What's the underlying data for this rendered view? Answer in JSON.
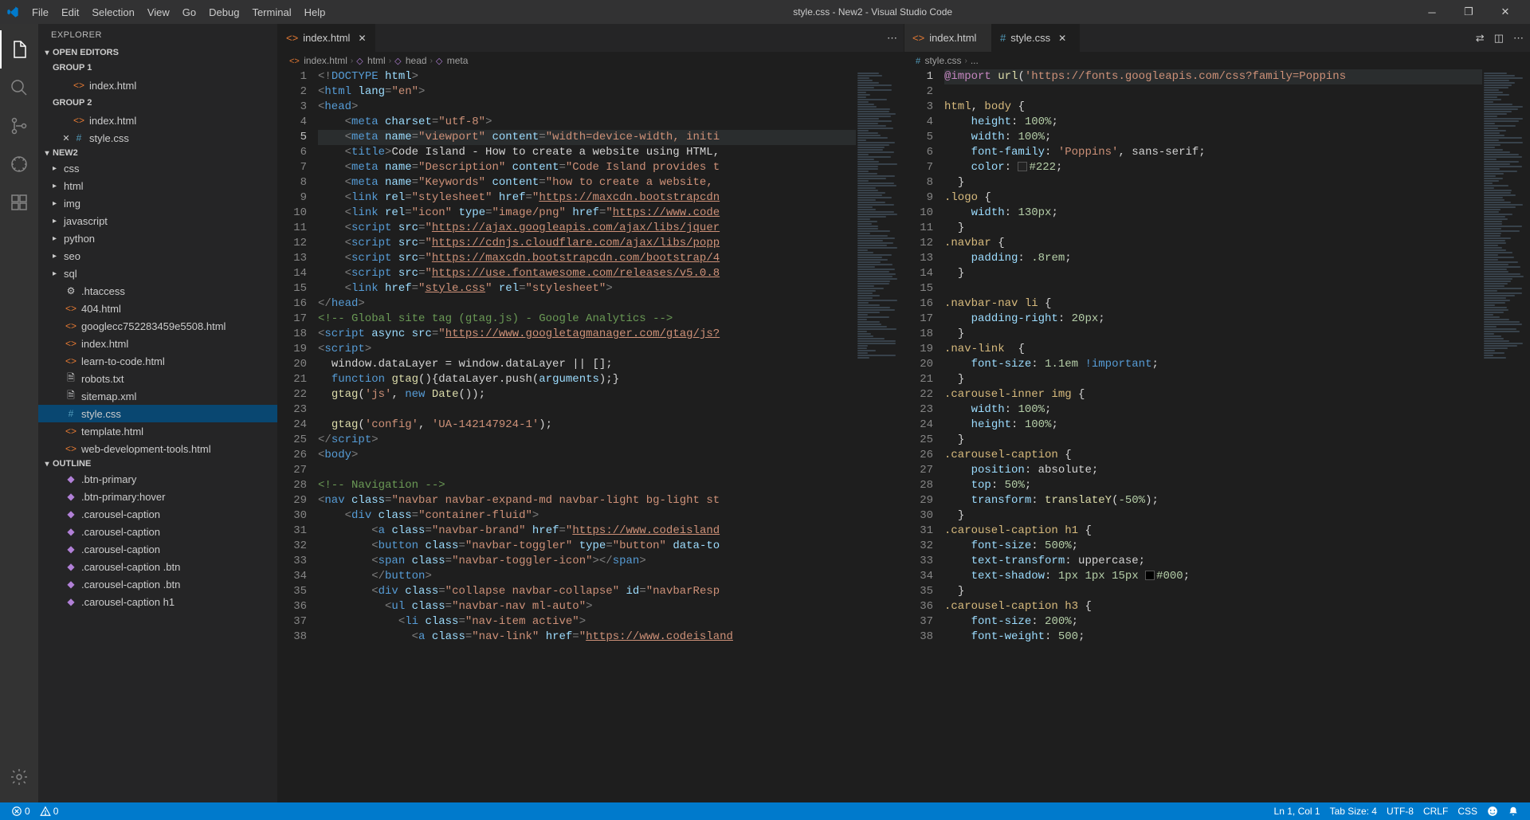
{
  "window": {
    "title": "style.css - New2 - Visual Studio Code"
  },
  "menu": [
    "File",
    "Edit",
    "Selection",
    "View",
    "Go",
    "Debug",
    "Terminal",
    "Help"
  ],
  "sidebar": {
    "title": "EXPLORER",
    "sections": {
      "openEditors": "OPEN EDITORS",
      "group1": "GROUP 1",
      "group2": "GROUP 2",
      "workspace": "NEW2",
      "outline": "OUTLINE"
    },
    "openEditors": {
      "g1": [
        "index.html"
      ],
      "g2": [
        "index.html",
        "style.css"
      ]
    },
    "folders": [
      "css",
      "html",
      "img",
      "javascript",
      "python",
      "seo",
      "sql"
    ],
    "files": [
      {
        "name": ".htaccess",
        "icon": "gear"
      },
      {
        "name": "404.html",
        "icon": "html"
      },
      {
        "name": "googlecc752283459e5508.html",
        "icon": "html"
      },
      {
        "name": "index.html",
        "icon": "html"
      },
      {
        "name": "learn-to-code.html",
        "icon": "html"
      },
      {
        "name": "robots.txt",
        "icon": "file"
      },
      {
        "name": "sitemap.xml",
        "icon": "file"
      },
      {
        "name": "style.css",
        "icon": "css",
        "selected": true
      },
      {
        "name": "template.html",
        "icon": "html"
      },
      {
        "name": "web-development-tools.html",
        "icon": "html"
      }
    ],
    "outline": [
      ".btn-primary",
      ".btn-primary:hover",
      ".carousel-caption",
      ".carousel-caption",
      ".carousel-caption",
      ".carousel-caption .btn",
      ".carousel-caption .btn",
      ".carousel-caption h1"
    ]
  },
  "editorGroups": [
    {
      "tabs": [
        {
          "name": "index.html",
          "icon": "html",
          "active": true
        }
      ],
      "breadcrumb": [
        "index.html",
        "html",
        "head",
        "meta"
      ],
      "activeLine": 5,
      "code": [
        {
          "n": 1,
          "html": "<span class='tok-pun'>&lt;!</span><span class='tok-tag'>DOCTYPE</span> <span class='tok-attr'>html</span><span class='tok-pun'>&gt;</span>"
        },
        {
          "n": 2,
          "html": "<span class='tok-pun'>&lt;</span><span class='tok-tag'>html</span> <span class='tok-attr'>lang</span><span class='tok-pun'>=</span><span class='tok-str'>\"en\"</span><span class='tok-pun'>&gt;</span>"
        },
        {
          "n": 3,
          "html": "<span class='tok-pun'>&lt;</span><span class='tok-tag'>head</span><span class='tok-pun'>&gt;</span>"
        },
        {
          "n": 4,
          "html": "    <span class='tok-pun'>&lt;</span><span class='tok-tag'>meta</span> <span class='tok-attr'>charset</span><span class='tok-pun'>=</span><span class='tok-str'>\"utf-8\"</span><span class='tok-pun'>&gt;</span>"
        },
        {
          "n": 5,
          "html": "    <span class='tok-pun'>&lt;</span><span class='tok-tag'>meta</span> <span class='tok-attr'>name</span><span class='tok-pun'>=</span><span class='tok-str'>\"viewport\"</span> <span class='tok-attr'>content</span><span class='tok-pun'>=</span><span class='tok-str'>\"width=device-width, initi</span>"
        },
        {
          "n": 6,
          "html": "    <span class='tok-pun'>&lt;</span><span class='tok-tag'>title</span><span class='tok-pun'>&gt;</span><span class='tok-txt'>Code Island - How to create a website using HTML,</span>"
        },
        {
          "n": 7,
          "html": "    <span class='tok-pun'>&lt;</span><span class='tok-tag'>meta</span> <span class='tok-attr'>name</span><span class='tok-pun'>=</span><span class='tok-str'>\"Description\"</span> <span class='tok-attr'>content</span><span class='tok-pun'>=</span><span class='tok-str'>\"Code Island provides t</span>"
        },
        {
          "n": 8,
          "html": "    <span class='tok-pun'>&lt;</span><span class='tok-tag'>meta</span> <span class='tok-attr'>name</span><span class='tok-pun'>=</span><span class='tok-str'>\"Keywords\"</span> <span class='tok-attr'>content</span><span class='tok-pun'>=</span><span class='tok-str'>\"how to create a website, </span>"
        },
        {
          "n": 9,
          "html": "    <span class='tok-pun'>&lt;</span><span class='tok-tag'>link</span> <span class='tok-attr'>rel</span><span class='tok-pun'>=</span><span class='tok-str'>\"stylesheet\"</span> <span class='tok-attr'>href</span><span class='tok-pun'>=</span><span class='tok-str'>\"</span><span class='tok-url'>https://maxcdn.bootstrapcdn</span>"
        },
        {
          "n": 10,
          "html": "    <span class='tok-pun'>&lt;</span><span class='tok-tag'>link</span> <span class='tok-attr'>rel</span><span class='tok-pun'>=</span><span class='tok-str'>\"icon\"</span> <span class='tok-attr'>type</span><span class='tok-pun'>=</span><span class='tok-str'>\"image/png\"</span> <span class='tok-attr'>href</span><span class='tok-pun'>=</span><span class='tok-str'>\"</span><span class='tok-url'>https://www.code</span>"
        },
        {
          "n": 11,
          "html": "    <span class='tok-pun'>&lt;</span><span class='tok-tag'>script</span> <span class='tok-attr'>src</span><span class='tok-pun'>=</span><span class='tok-str'>\"</span><span class='tok-url'>https://ajax.googleapis.com/ajax/libs/jquer</span>"
        },
        {
          "n": 12,
          "html": "    <span class='tok-pun'>&lt;</span><span class='tok-tag'>script</span> <span class='tok-attr'>src</span><span class='tok-pun'>=</span><span class='tok-str'>\"</span><span class='tok-url'>https://cdnjs.cloudflare.com/ajax/libs/popp</span>"
        },
        {
          "n": 13,
          "html": "    <span class='tok-pun'>&lt;</span><span class='tok-tag'>script</span> <span class='tok-attr'>src</span><span class='tok-pun'>=</span><span class='tok-str'>\"</span><span class='tok-url'>https://maxcdn.bootstrapcdn.com/bootstrap/4</span>"
        },
        {
          "n": 14,
          "html": "    <span class='tok-pun'>&lt;</span><span class='tok-tag'>script</span> <span class='tok-attr'>src</span><span class='tok-pun'>=</span><span class='tok-str'>\"</span><span class='tok-url'>https://use.fontawesome.com/releases/v5.0.8</span>"
        },
        {
          "n": 15,
          "html": "    <span class='tok-pun'>&lt;</span><span class='tok-tag'>link</span> <span class='tok-attr'>href</span><span class='tok-pun'>=</span><span class='tok-str'>\"</span><span class='tok-url'>style.css</span><span class='tok-str'>\"</span> <span class='tok-attr'>rel</span><span class='tok-pun'>=</span><span class='tok-str'>\"stylesheet\"</span><span class='tok-pun'>&gt;</span>"
        },
        {
          "n": 16,
          "html": "<span class='tok-pun'>&lt;/</span><span class='tok-tag'>head</span><span class='tok-pun'>&gt;</span>"
        },
        {
          "n": 17,
          "html": "<span class='tok-comment'>&lt;!-- Global site tag (gtag.js) - Google Analytics --&gt;</span>"
        },
        {
          "n": 18,
          "html": "<span class='tok-pun'>&lt;</span><span class='tok-tag'>script</span> <span class='tok-attr'>async</span> <span class='tok-attr'>src</span><span class='tok-pun'>=</span><span class='tok-str'>\"</span><span class='tok-url'>https://www.googletagmanager.com/gtag/js?</span>"
        },
        {
          "n": 19,
          "html": "<span class='tok-pun'>&lt;</span><span class='tok-tag'>script</span><span class='tok-pun'>&gt;</span>"
        },
        {
          "n": 20,
          "html": "  <span class='tok-txt'>window.dataLayer = window.dataLayer || [];</span>"
        },
        {
          "n": 21,
          "html": "  <span class='tok-tag'>function</span> <span class='tok-func'>gtag</span><span class='tok-txt'>(){dataLayer.push(</span><span class='tok-attr'>arguments</span><span class='tok-txt'>);}</span>"
        },
        {
          "n": 22,
          "html": "  <span class='tok-func'>gtag</span><span class='tok-txt'>(</span><span class='tok-str'>'js'</span><span class='tok-txt'>, </span><span class='tok-tag'>new</span> <span class='tok-func'>Date</span><span class='tok-txt'>());</span>"
        },
        {
          "n": 23,
          "html": ""
        },
        {
          "n": 24,
          "html": "  <span class='tok-func'>gtag</span><span class='tok-txt'>(</span><span class='tok-str'>'config'</span><span class='tok-txt'>, </span><span class='tok-str'>'UA-142147924-1'</span><span class='tok-txt'>);</span>"
        },
        {
          "n": 25,
          "html": "<span class='tok-pun'>&lt;/</span><span class='tok-tag'>script</span><span class='tok-pun'>&gt;</span>"
        },
        {
          "n": 26,
          "html": "<span class='tok-pun'>&lt;</span><span class='tok-tag'>body</span><span class='tok-pun'>&gt;</span>"
        },
        {
          "n": 27,
          "html": ""
        },
        {
          "n": 28,
          "html": "<span class='tok-comment'>&lt;!-- Navigation --&gt;</span>"
        },
        {
          "n": 29,
          "html": "<span class='tok-pun'>&lt;</span><span class='tok-tag'>nav</span> <span class='tok-attr'>class</span><span class='tok-pun'>=</span><span class='tok-str'>\"navbar navbar-expand-md navbar-light bg-light st</span>"
        },
        {
          "n": 30,
          "html": "    <span class='tok-pun'>&lt;</span><span class='tok-tag'>div</span> <span class='tok-attr'>class</span><span class='tok-pun'>=</span><span class='tok-str'>\"container-fluid\"</span><span class='tok-pun'>&gt;</span>"
        },
        {
          "n": 31,
          "html": "        <span class='tok-pun'>&lt;</span><span class='tok-tag'>a</span> <span class='tok-attr'>class</span><span class='tok-pun'>=</span><span class='tok-str'>\"navbar-brand\"</span> <span class='tok-attr'>href</span><span class='tok-pun'>=</span><span class='tok-str'>\"</span><span class='tok-url'>https://www.codeisland</span>"
        },
        {
          "n": 32,
          "html": "        <span class='tok-pun'>&lt;</span><span class='tok-tag'>button</span> <span class='tok-attr'>class</span><span class='tok-pun'>=</span><span class='tok-str'>\"navbar-toggler\"</span> <span class='tok-attr'>type</span><span class='tok-pun'>=</span><span class='tok-str'>\"button\"</span> <span class='tok-attr'>data-to</span>"
        },
        {
          "n": 33,
          "html": "        <span class='tok-pun'>&lt;</span><span class='tok-tag'>span</span> <span class='tok-attr'>class</span><span class='tok-pun'>=</span><span class='tok-str'>\"navbar-toggler-icon\"</span><span class='tok-pun'>&gt;&lt;/</span><span class='tok-tag'>span</span><span class='tok-pun'>&gt;</span>"
        },
        {
          "n": 34,
          "html": "        <span class='tok-pun'>&lt;/</span><span class='tok-tag'>button</span><span class='tok-pun'>&gt;</span>"
        },
        {
          "n": 35,
          "html": "        <span class='tok-pun'>&lt;</span><span class='tok-tag'>div</span> <span class='tok-attr'>class</span><span class='tok-pun'>=</span><span class='tok-str'>\"collapse navbar-collapse\"</span> <span class='tok-attr'>id</span><span class='tok-pun'>=</span><span class='tok-str'>\"navbarResp</span>"
        },
        {
          "n": 36,
          "html": "          <span class='tok-pun'>&lt;</span><span class='tok-tag'>ul</span> <span class='tok-attr'>class</span><span class='tok-pun'>=</span><span class='tok-str'>\"navbar-nav ml-auto\"</span><span class='tok-pun'>&gt;</span>"
        },
        {
          "n": 37,
          "html": "            <span class='tok-pun'>&lt;</span><span class='tok-tag'>li</span> <span class='tok-attr'>class</span><span class='tok-pun'>=</span><span class='tok-str'>\"nav-item active\"</span><span class='tok-pun'>&gt;</span>"
        },
        {
          "n": 38,
          "html": "              <span class='tok-pun'>&lt;</span><span class='tok-tag'>a</span> <span class='tok-attr'>class</span><span class='tok-pun'>=</span><span class='tok-str'>\"nav-link\"</span> <span class='tok-attr'>href</span><span class='tok-pun'>=</span><span class='tok-str'>\"</span><span class='tok-url'>https://www.codeisland</span>"
        }
      ]
    },
    {
      "tabs": [
        {
          "name": "index.html",
          "icon": "html",
          "active": false
        },
        {
          "name": "style.css",
          "icon": "css",
          "active": true
        }
      ],
      "breadcrumb": [
        "style.css",
        "..."
      ],
      "activeLine": 1,
      "code": [
        {
          "n": 1,
          "html": "<span class='tok-atrule'>@import</span> <span class='tok-func'>url</span><span class='tok-txt'>(</span><span class='tok-str'>'https://fonts.googleapis.com/css?family=Poppins</span>"
        },
        {
          "n": 2,
          "html": ""
        },
        {
          "n": 3,
          "html": "<span class='tok-sel'>html</span><span class='tok-txt'>, </span><span class='tok-sel'>body</span> <span class='tok-txt'>{</span>"
        },
        {
          "n": 4,
          "html": "    <span class='tok-prop'>height</span><span class='tok-txt'>: </span><span class='tok-num'>100%</span><span class='tok-txt'>;</span>"
        },
        {
          "n": 5,
          "html": "    <span class='tok-prop'>width</span><span class='tok-txt'>: </span><span class='tok-num'>100%</span><span class='tok-txt'>;</span>"
        },
        {
          "n": 6,
          "html": "    <span class='tok-prop'>font-family</span><span class='tok-txt'>: </span><span class='tok-str'>'Poppins'</span><span class='tok-txt'>, sans-serif;</span>"
        },
        {
          "n": 7,
          "html": "    <span class='tok-prop'>color</span><span class='tok-txt'>: </span><span class='color-box' style='background:#222'></span><span class='tok-num'>#222</span><span class='tok-txt'>;</span>"
        },
        {
          "n": 8,
          "html": "  <span class='tok-txt'>}</span>"
        },
        {
          "n": 9,
          "html": "<span class='tok-sel'>.logo</span> <span class='tok-txt'>{</span>"
        },
        {
          "n": 10,
          "html": "    <span class='tok-prop'>width</span><span class='tok-txt'>: </span><span class='tok-num'>130px</span><span class='tok-txt'>;</span>"
        },
        {
          "n": 11,
          "html": "  <span class='tok-txt'>}</span>"
        },
        {
          "n": 12,
          "html": "<span class='tok-sel'>.navbar</span> <span class='tok-txt'>{</span>"
        },
        {
          "n": 13,
          "html": "    <span class='tok-prop'>padding</span><span class='tok-txt'>: </span><span class='tok-num'>.8rem</span><span class='tok-txt'>;</span>"
        },
        {
          "n": 14,
          "html": "  <span class='tok-txt'>}</span>"
        },
        {
          "n": 15,
          "html": ""
        },
        {
          "n": 16,
          "html": "<span class='tok-sel'>.navbar-nav li</span> <span class='tok-txt'>{</span>"
        },
        {
          "n": 17,
          "html": "    <span class='tok-prop'>padding-right</span><span class='tok-txt'>: </span><span class='tok-num'>20px</span><span class='tok-txt'>;</span>"
        },
        {
          "n": 18,
          "html": "  <span class='tok-txt'>}</span>"
        },
        {
          "n": 19,
          "html": "<span class='tok-sel'>.nav-link</span>  <span class='tok-txt'>{</span>"
        },
        {
          "n": 20,
          "html": "    <span class='tok-prop'>font-size</span><span class='tok-txt'>: </span><span class='tok-num'>1.1em</span> <span class='tok-important'>!important</span><span class='tok-txt'>;</span>"
        },
        {
          "n": 21,
          "html": "  <span class='tok-txt'>}</span>"
        },
        {
          "n": 22,
          "html": "<span class='tok-sel'>.carousel-inner img</span> <span class='tok-txt'>{</span>"
        },
        {
          "n": 23,
          "html": "    <span class='tok-prop'>width</span><span class='tok-txt'>: </span><span class='tok-num'>100%</span><span class='tok-txt'>;</span>"
        },
        {
          "n": 24,
          "html": "    <span class='tok-prop'>height</span><span class='tok-txt'>: </span><span class='tok-num'>100%</span><span class='tok-txt'>;</span>"
        },
        {
          "n": 25,
          "html": "  <span class='tok-txt'>}</span>"
        },
        {
          "n": 26,
          "html": "<span class='tok-sel'>.carousel-caption</span> <span class='tok-txt'>{</span>"
        },
        {
          "n": 27,
          "html": "    <span class='tok-prop'>position</span><span class='tok-txt'>: absolute;</span>"
        },
        {
          "n": 28,
          "html": "    <span class='tok-prop'>top</span><span class='tok-txt'>: </span><span class='tok-num'>50%</span><span class='tok-txt'>;</span>"
        },
        {
          "n": 29,
          "html": "    <span class='tok-prop'>transform</span><span class='tok-txt'>: </span><span class='tok-func'>translateY</span><span class='tok-txt'>(</span><span class='tok-num'>-50%</span><span class='tok-txt'>);</span>"
        },
        {
          "n": 30,
          "html": "  <span class='tok-txt'>}</span>"
        },
        {
          "n": 31,
          "html": "<span class='tok-sel'>.carousel-caption h1</span> <span class='tok-txt'>{</span>"
        },
        {
          "n": 32,
          "html": "    <span class='tok-prop'>font-size</span><span class='tok-txt'>: </span><span class='tok-num'>500%</span><span class='tok-txt'>;</span>"
        },
        {
          "n": 33,
          "html": "    <span class='tok-prop'>text-transform</span><span class='tok-txt'>: uppercase;</span>"
        },
        {
          "n": 34,
          "html": "    <span class='tok-prop'>text-shadow</span><span class='tok-txt'>: </span><span class='tok-num'>1px 1px 15px</span> <span class='color-box' style='background:#000'></span><span class='tok-num'>#000</span><span class='tok-txt'>;</span>"
        },
        {
          "n": 35,
          "html": "  <span class='tok-txt'>}</span>"
        },
        {
          "n": 36,
          "html": "<span class='tok-sel'>.carousel-caption h3</span> <span class='tok-txt'>{</span>"
        },
        {
          "n": 37,
          "html": "    <span class='tok-prop'>font-size</span><span class='tok-txt'>: </span><span class='tok-num'>200%</span><span class='tok-txt'>;</span>"
        },
        {
          "n": 38,
          "html": "    <span class='tok-prop'>font-weight</span><span class='tok-txt'>: </span><span class='tok-num'>500</span><span class='tok-txt'>;</span>"
        }
      ]
    }
  ],
  "statusbar": {
    "errors": "0",
    "warnings": "0",
    "lncol": "Ln 1, Col 1",
    "tabsize": "Tab Size: 4",
    "encoding": "UTF-8",
    "eol": "CRLF",
    "lang": "CSS"
  }
}
